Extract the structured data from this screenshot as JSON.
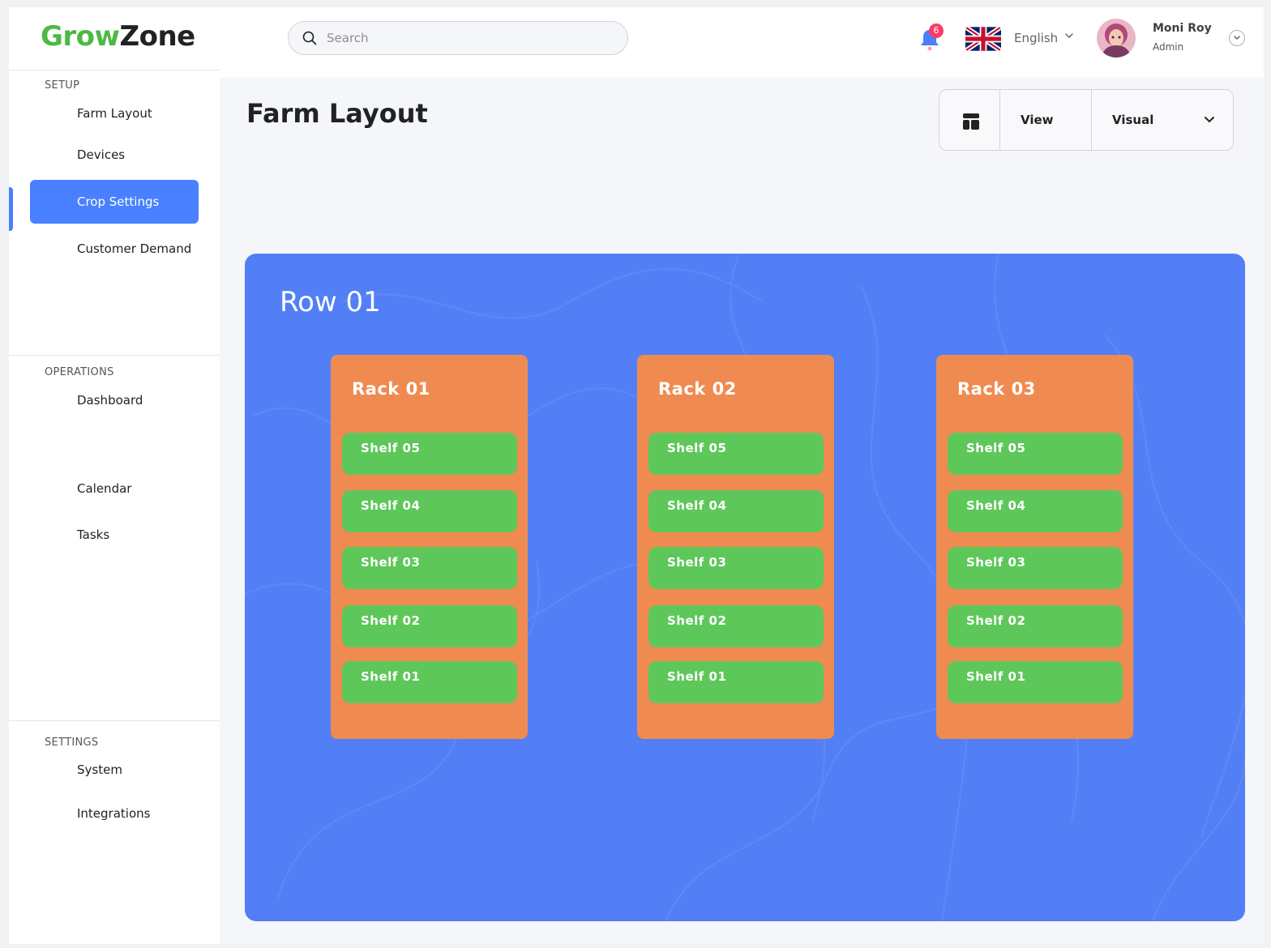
{
  "brand": {
    "grow": "Grow",
    "zone": "Zone"
  },
  "search": {
    "placeholder": "Search",
    "value": ""
  },
  "notifications": {
    "count": "6"
  },
  "language": {
    "label": "English"
  },
  "user": {
    "name": "Moni Roy",
    "role": "Admin"
  },
  "sidebar": {
    "sections": [
      {
        "title": "SETUP",
        "items": [
          "Farm Layout",
          "Devices",
          "Crop Settings",
          "Customer Demand"
        ]
      },
      {
        "title": "OPERATIONS",
        "items": [
          "Dashboard",
          "Calendar",
          "Tasks"
        ]
      },
      {
        "title": "SETTINGS",
        "items": [
          "System",
          "Integrations"
        ]
      }
    ],
    "active": "Crop Settings"
  },
  "main": {
    "title": "Farm Layout",
    "view_label": "View",
    "view_mode": "Visual",
    "row": {
      "title": "Row 01",
      "racks": [
        {
          "title": "Rack 01",
          "shelves": [
            "Shelf 05",
            "Shelf 04",
            "Shelf 03",
            "Shelf 02",
            "Shelf 01"
          ]
        },
        {
          "title": "Rack 02",
          "shelves": [
            "Shelf 05",
            "Shelf 04",
            "Shelf 03",
            "Shelf 02",
            "Shelf 01"
          ]
        },
        {
          "title": "Rack 03",
          "shelves": [
            "Shelf 05",
            "Shelf 04",
            "Shelf 03",
            "Shelf 02",
            "Shelf 01"
          ]
        }
      ]
    }
  },
  "colors": {
    "brand_green": "#4cb944",
    "accent_blue": "#4880ff",
    "row_blue": "#537ff6",
    "rack_orange": "#ef8b50",
    "shelf_green": "#5ec75a",
    "badge_red": "#f93c65"
  },
  "icons": [
    "search-icon",
    "bell-icon",
    "uk-flag-icon",
    "chevron-down-icon",
    "layout-icon"
  ]
}
